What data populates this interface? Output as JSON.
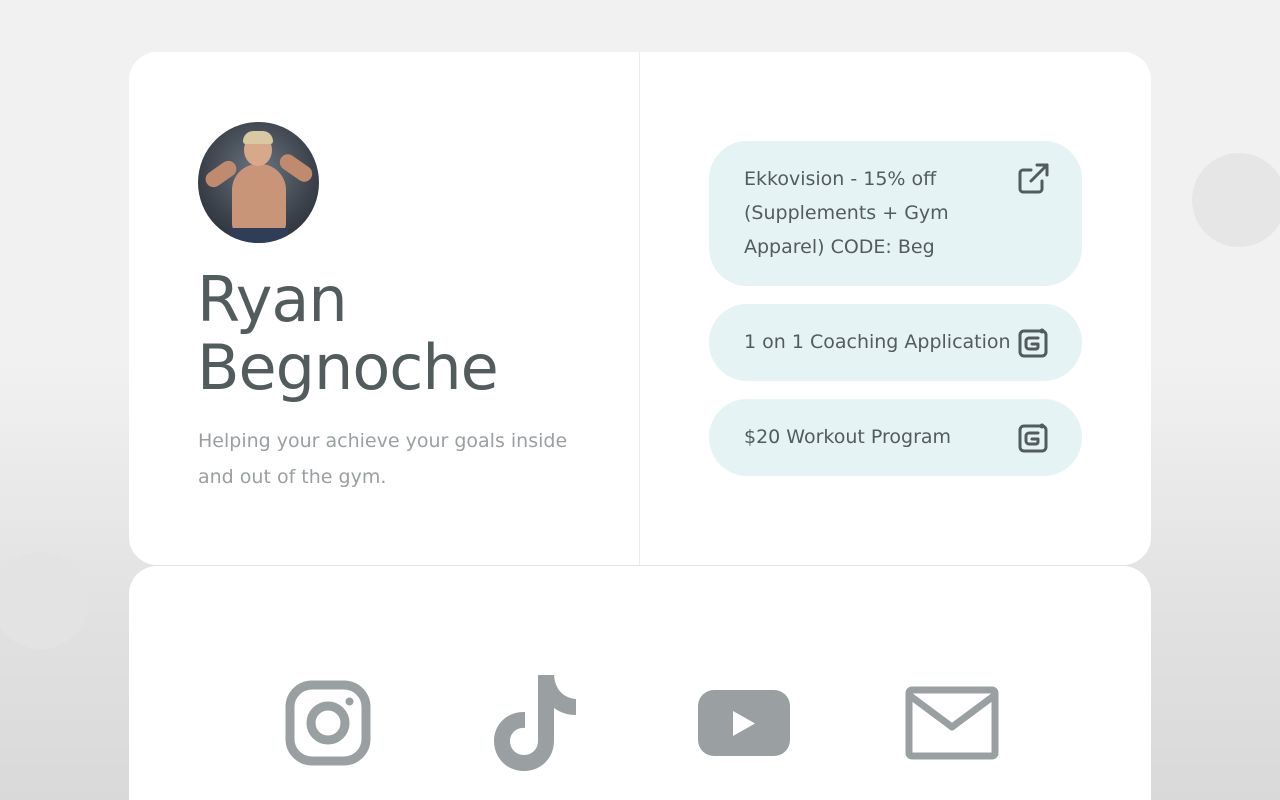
{
  "profile": {
    "name": "Ryan Begnoche",
    "bio": "Helping your achieve your goals inside and out of the gym."
  },
  "links": [
    {
      "label": "Ekkovision - 15% off (Supplements + Gym Apparel) CODE: Beg",
      "icon": "external-link-icon"
    },
    {
      "label": "1 on 1 Coaching Application",
      "icon": "form-icon"
    },
    {
      "label": "$20 Workout Program",
      "icon": "form-icon"
    }
  ],
  "socials": [
    {
      "name": "Instagram",
      "icon": "instagram-icon"
    },
    {
      "name": "TikTok",
      "icon": "tiktok-icon"
    },
    {
      "name": "YouTube",
      "icon": "youtube-icon"
    },
    {
      "name": "Email",
      "icon": "mail-icon"
    }
  ],
  "colors": {
    "text": "#535c5c",
    "muted": "#9a9fa2",
    "button_bg": "#e6f3f5",
    "icon_gray": "#9aa0a2"
  }
}
